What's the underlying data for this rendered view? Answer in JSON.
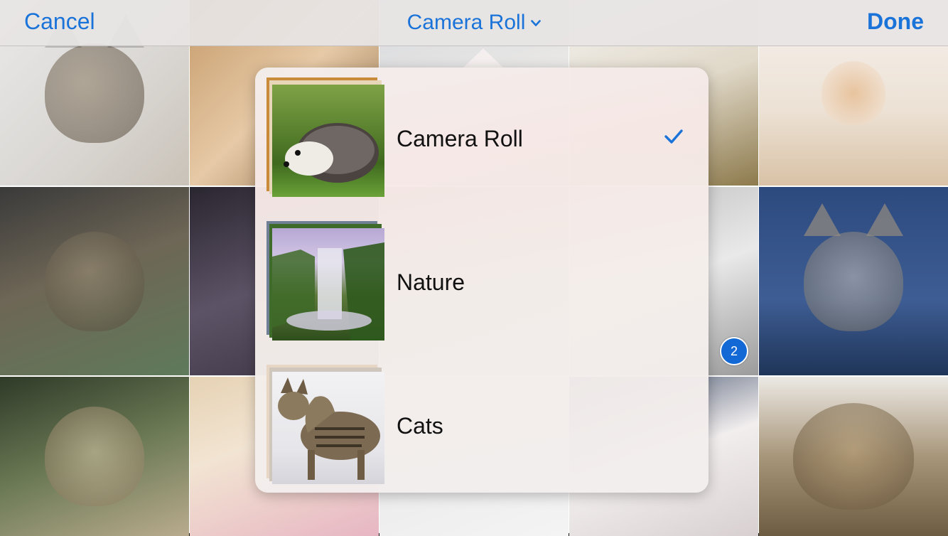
{
  "navbar": {
    "cancel_label": "Cancel",
    "title": "Camera Roll",
    "done_label": "Done",
    "accent_color": "#1a73d8"
  },
  "photo_grid": {
    "rows": [
      [
        "tabby-cat-photo",
        "kitten-closeup-photo",
        "white-kitten-photo",
        "white-kitten-blue-eyes-photo",
        "orange-white-kitten-photo"
      ],
      [
        "tabby-cat-tag-photo",
        "blurred-kitten-photo",
        "gray-kitten-photo",
        "gray-kitten-selected-photo",
        "fluffy-kitten-bowl-photo"
      ],
      [
        "kitten-looking-up-photo",
        "kitten-hat-flowers-photo",
        "white-cat-photo",
        "white-cat-2-photo",
        "pallas-cat-photo"
      ]
    ],
    "selected_badge": "2"
  },
  "album_picker": {
    "albums": [
      {
        "label": "Camera Roll",
        "thumbnail": "hedgehog-thumbnail",
        "selected": true
      },
      {
        "label": "Nature",
        "thumbnail": "waterfall-thumbnail",
        "selected": false
      },
      {
        "label": "Cats",
        "thumbnail": "cat-thumbnail",
        "selected": false
      }
    ],
    "checkmark_icon": "checkmark-icon"
  }
}
